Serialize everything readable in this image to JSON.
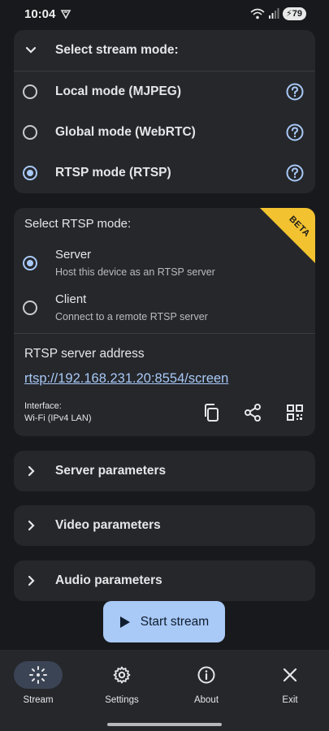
{
  "status": {
    "time": "10:04",
    "battery": "79"
  },
  "stream_mode": {
    "title": "Select stream mode:",
    "options": [
      {
        "label": "Local mode (MJPEG)",
        "selected": false
      },
      {
        "label": "Global mode (WebRTC)",
        "selected": false
      },
      {
        "label": "RTSP mode (RTSP)",
        "selected": true
      }
    ]
  },
  "rtsp_mode": {
    "title": "Select RTSP mode:",
    "badge": "BETA",
    "options": [
      {
        "title": "Server",
        "subtitle": "Host this device as an RTSP server",
        "selected": true
      },
      {
        "title": "Client",
        "subtitle": "Connect to a remote RTSP server",
        "selected": false
      }
    ],
    "address_label": "RTSP server address",
    "address": "rtsp://192.168.231.20:8554/screen",
    "interface_label": "Interface:",
    "interface_value": "Wi-Fi (IPv4 LAN)"
  },
  "sections": [
    {
      "label": "Server parameters"
    },
    {
      "label": "Video parameters"
    },
    {
      "label": "Audio parameters"
    }
  ],
  "start_button": "Start stream",
  "nav": [
    {
      "label": "Stream",
      "icon": "stream-icon",
      "active": true
    },
    {
      "label": "Settings",
      "icon": "gear-icon",
      "active": false
    },
    {
      "label": "About",
      "icon": "info-icon",
      "active": false
    },
    {
      "label": "Exit",
      "icon": "close-icon",
      "active": false
    }
  ],
  "colors": {
    "accent": "#a9c9f7",
    "beta": "#f2c230",
    "card": "#25272b",
    "background": "#17191c"
  }
}
